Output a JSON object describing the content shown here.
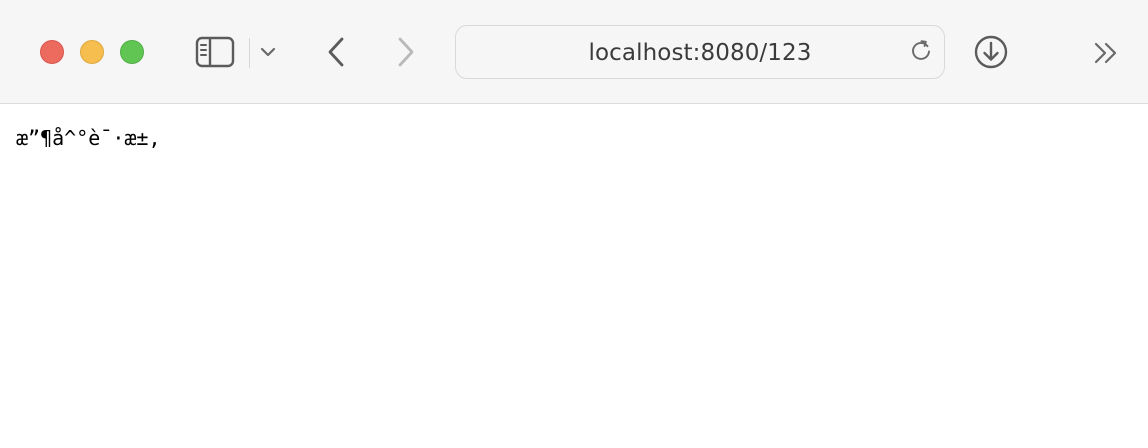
{
  "window": {
    "controls": {
      "close_color": "#ed6a5e",
      "minimize_color": "#f5be4f",
      "maximize_color": "#61c554"
    }
  },
  "toolbar": {
    "icons": {
      "sidebar": "sidebar-toggle-icon",
      "tabs_menu": "chevron-down-icon",
      "back": "chevron-left-icon",
      "forward": "chevron-right-icon",
      "reload": "reload-icon",
      "download": "download-icon",
      "overflow": "double-chevron-right-icon"
    }
  },
  "address_bar": {
    "url": "localhost:8080/123"
  },
  "page": {
    "body_text": "æ”¶å^°è¯·æ±‚"
  }
}
